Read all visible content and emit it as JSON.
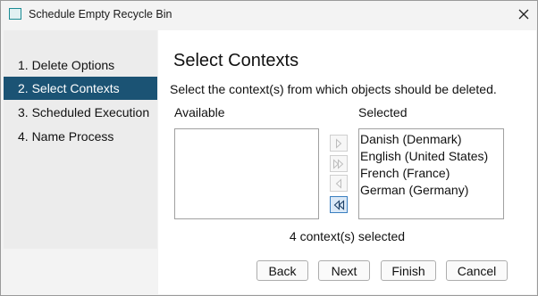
{
  "window": {
    "title": "Schedule Empty Recycle Bin"
  },
  "sidebar": {
    "steps": [
      {
        "label": "1. Delete Options"
      },
      {
        "label": "2. Select Contexts"
      },
      {
        "label": "3. Scheduled Execution"
      },
      {
        "label": "4. Name Process"
      }
    ],
    "active_index": 1
  },
  "main": {
    "heading": "Select Contexts",
    "instruction": "Select the context(s) from which objects should be deleted.",
    "available_label": "Available",
    "selected_label": "Selected",
    "available_items": [],
    "selected_items": [
      "Danish (Denmark)",
      "English (United States)",
      "French (France)",
      "German (Germany)"
    ],
    "movers": [
      {
        "icon": "move-right-icon",
        "enabled": false
      },
      {
        "icon": "move-all-right-icon",
        "enabled": false
      },
      {
        "icon": "move-left-icon",
        "enabled": false
      },
      {
        "icon": "move-all-left-icon",
        "enabled": true
      }
    ],
    "count_text": "4 context(s) selected"
  },
  "buttons": {
    "back": "Back",
    "next": "Next",
    "finish": "Finish",
    "cancel": "Cancel"
  },
  "colors": {
    "accent": "#1b5374",
    "titlebar_icon": "#1d8c94",
    "enabled_button_border": "#3a7fc0"
  }
}
